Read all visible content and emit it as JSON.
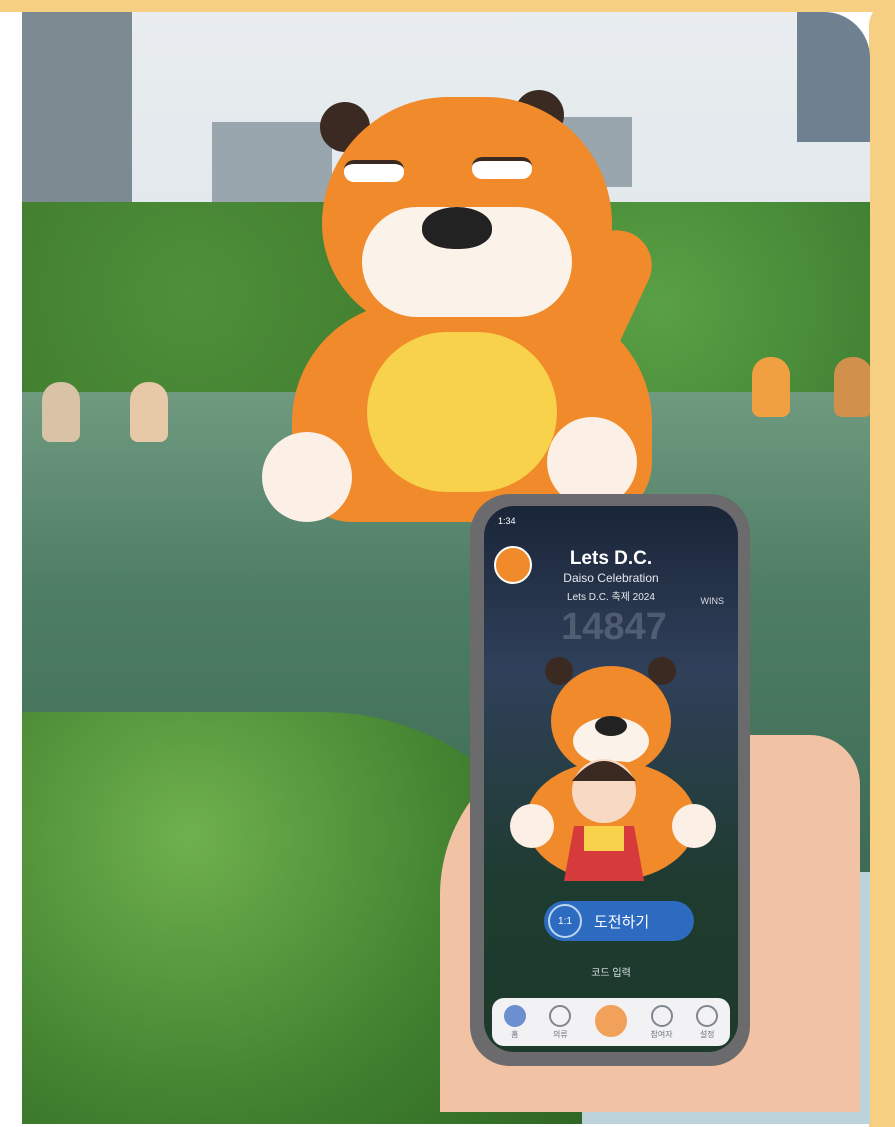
{
  "app": {
    "title": "Lets D.C.",
    "subtitle": "Daiso Celebration",
    "caption": "Lets D.C. 축제 2024",
    "counter": "14847",
    "ticker": "WINS",
    "challenge_button": "도전하기",
    "challenge_icon_text": "1:1",
    "bottom_link": "코드 입력",
    "status_time": "1:34",
    "tabs": [
      "홈",
      "의류",
      "",
      "참여자",
      "설정"
    ]
  }
}
